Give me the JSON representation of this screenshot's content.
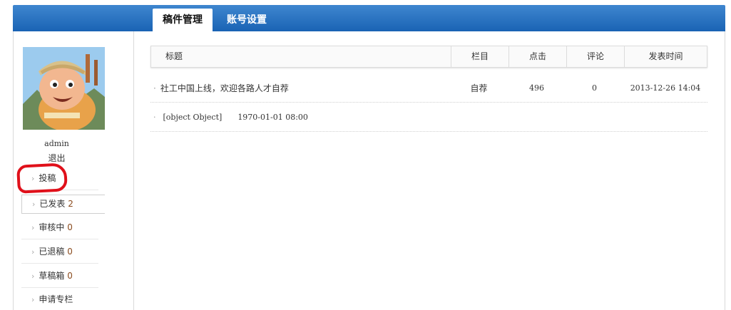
{
  "tabs": {
    "manage": "稿件管理",
    "account": "账号设置"
  },
  "user": {
    "name": "admin",
    "logout": "退出"
  },
  "menu": [
    {
      "label": "投稿",
      "count": ""
    },
    {
      "label": "已发表",
      "count": "2"
    },
    {
      "label": "审核中",
      "count": "0"
    },
    {
      "label": "已退稿",
      "count": "0"
    },
    {
      "label": "草稿箱",
      "count": "0"
    },
    {
      "label": "申请专栏",
      "count": ""
    }
  ],
  "icons": {
    "chevron": "›",
    "bullet": "·"
  },
  "table": {
    "headers": {
      "title": "标题",
      "column": "栏目",
      "clicks": "点击",
      "comments": "评论",
      "time": "发表时间"
    },
    "rows": [
      {
        "title": "社工中国上线，欢迎各路人才自荐",
        "column": "自荐",
        "clicks": "496",
        "comments": "0",
        "time": "2013-12-26 14:04"
      },
      {
        "title": "[object Object]",
        "time": "1970-01-01 08:00"
      }
    ]
  },
  "colors": {
    "topbar": "#1a63b4",
    "annotation": "#e0101a",
    "count": "#8a4b1e"
  }
}
